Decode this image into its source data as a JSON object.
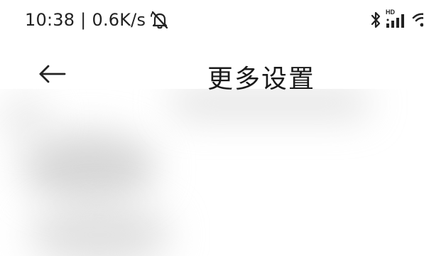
{
  "status_bar": {
    "time": "10:38",
    "separator": "|",
    "net_speed": "0.6K/s",
    "icons": {
      "mute": "notification-off-icon",
      "bluetooth": "bluetooth-icon",
      "signal": "hd-signal-icon",
      "wifi": "wifi-icon"
    },
    "hd_label": "HD"
  },
  "header": {
    "back_icon": "arrow-left-icon",
    "title": "更多设置"
  },
  "colors": {
    "background": "#ffffff",
    "text": "#1a1a1a",
    "placeholder": "#d0d0d0"
  }
}
